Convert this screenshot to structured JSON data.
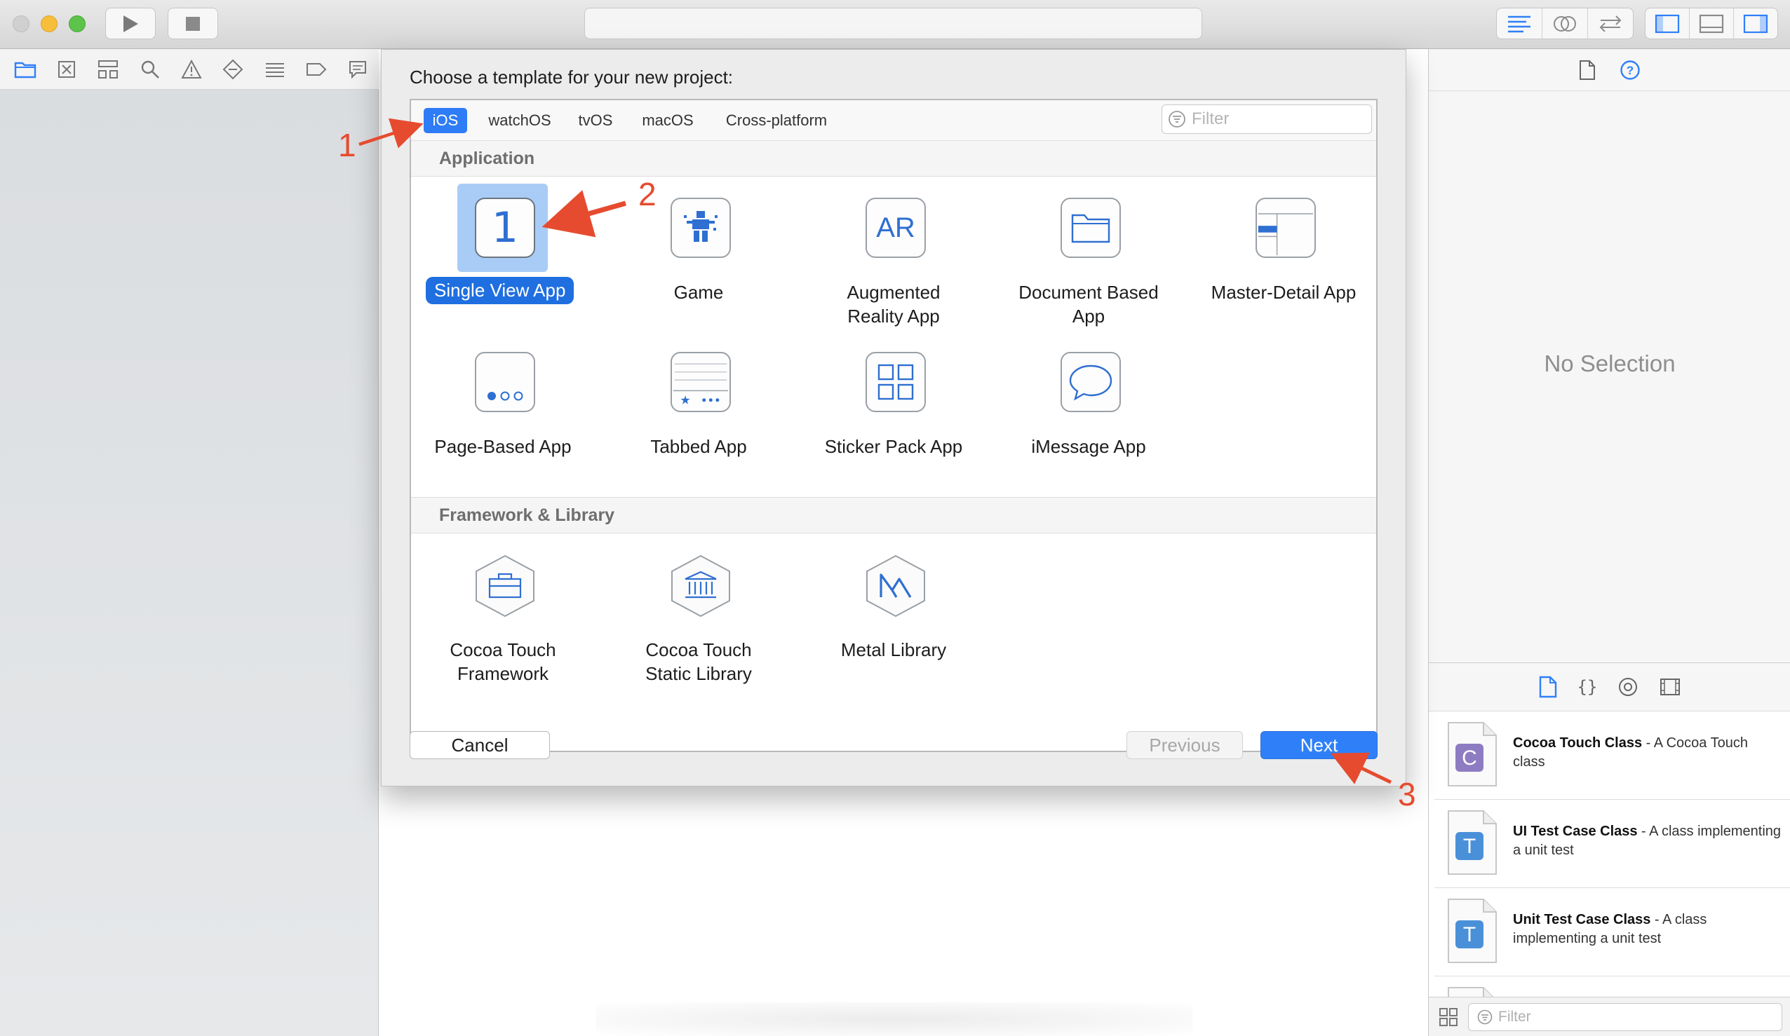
{
  "dialog": {
    "title": "Choose a template for your new project:",
    "platform_tabs": [
      {
        "label": "iOS",
        "selected": true
      },
      {
        "label": "watchOS",
        "selected": false
      },
      {
        "label": "tvOS",
        "selected": false
      },
      {
        "label": "macOS",
        "selected": false
      },
      {
        "label": "Cross-platform",
        "selected": false
      }
    ],
    "filter_placeholder": "Filter",
    "sections": [
      {
        "title": "Application",
        "templates": [
          {
            "label": "Single View App",
            "icon": "single-view-icon",
            "selected": true
          },
          {
            "label": "Game",
            "icon": "game-icon"
          },
          {
            "label_lines": [
              "Augmented",
              "Reality App"
            ],
            "icon": "ar-icon",
            "icon_text": "AR"
          },
          {
            "label_lines": [
              "Document Based",
              "App"
            ],
            "icon": "folder-icon"
          },
          {
            "label": "Master-Detail App",
            "icon": "master-detail-icon"
          },
          {
            "label": "Page-Based App",
            "icon": "page-dots-icon"
          },
          {
            "label": "Tabbed App",
            "icon": "tab-bar-icon"
          },
          {
            "label": "Sticker Pack App",
            "icon": "sticker-grid-icon"
          },
          {
            "label": "iMessage App",
            "icon": "speech-bubble-icon"
          }
        ]
      },
      {
        "title": "Framework & Library",
        "templates": [
          {
            "label_lines": [
              "Cocoa Touch",
              "Framework"
            ],
            "icon": "toolbox-hex-icon"
          },
          {
            "label_lines": [
              "Cocoa Touch",
              "Static Library"
            ],
            "icon": "library-hex-icon"
          },
          {
            "label": "Metal Library",
            "icon": "metal-hex-icon"
          }
        ]
      }
    ],
    "single_view_glyph": "1",
    "buttons": {
      "cancel": "Cancel",
      "previous": "Previous",
      "next": "Next"
    }
  },
  "inspector": {
    "no_selection": "No Selection",
    "library_items": [
      {
        "name": "Cocoa Touch Class",
        "desc": " - A Cocoa Touch class",
        "letter": "C",
        "letter_color": "#8e7cc3"
      },
      {
        "name": "UI Test Case Class",
        "desc": " - A class implementing a unit test",
        "letter": "T",
        "letter_color": "#4a90d9"
      },
      {
        "name": "Unit Test Case Class",
        "desc": " - A class implementing a unit test",
        "letter": "T",
        "letter_color": "#4a90d9"
      }
    ],
    "library_filter_placeholder": "Filter"
  },
  "annotations": {
    "n1": "1",
    "n2": "2",
    "n3": "3",
    "color": "#e64b2f"
  },
  "colors": {
    "accent": "#2f80f8",
    "selection": "#a8ccf5",
    "annotation": "#e64b2f"
  }
}
